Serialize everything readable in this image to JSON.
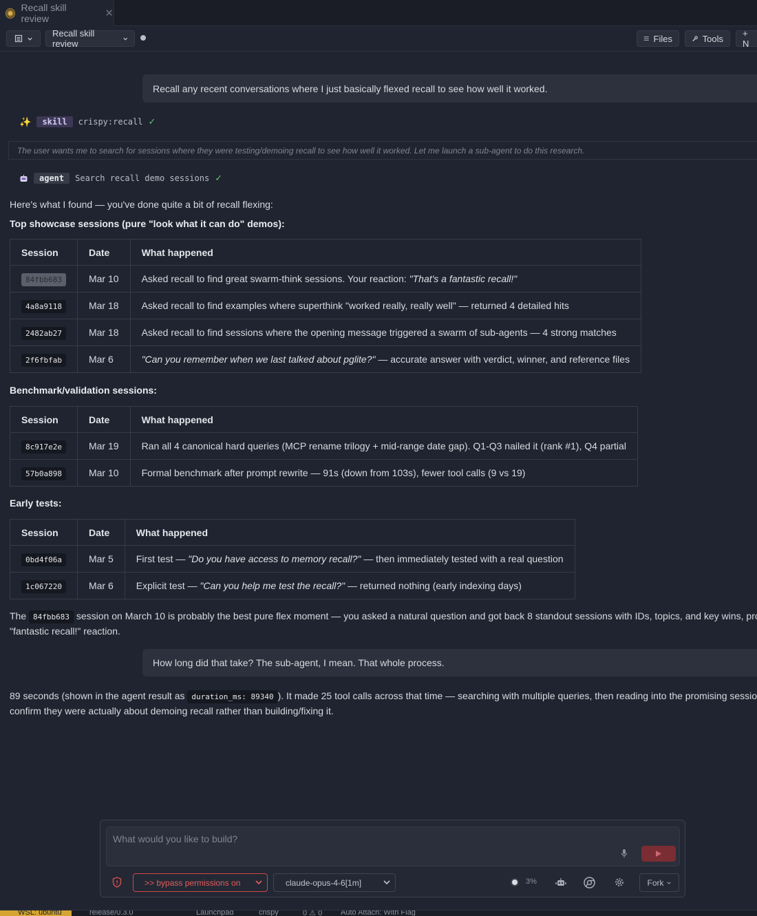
{
  "tab": {
    "title": "Recall skill review",
    "close": "✕"
  },
  "toolbar": {
    "session_name": "Recall skill review",
    "files_label": "Files",
    "tools_label": "Tools",
    "new_label": "+ N"
  },
  "messages": {
    "user1": "Recall any recent conversations where I just basically flexed recall to see how well it worked.",
    "skill_pill": "skill",
    "skill_name": "crispy:recall",
    "thinking": "The user wants me to search for sessions where they were testing/demoing recall to see how well it worked. Let me launch a sub-agent to do this research.",
    "agent_pill": "agent",
    "agent_task": "Search recall demo sessions",
    "intro": "Here's what I found — you've done quite a bit of recall flexing:",
    "heading1": "Top showcase sessions (pure \"look what it can do\" demos):",
    "heading2": "Benchmark/validation sessions:",
    "heading3": "Early tests:",
    "summary_pre": "The",
    "summary_code": "84fbb683",
    "summary_post": "session on March 10 is probably the best pure flex moment — you asked a natural question and got back 8 standout sessions with IDs, topics, and key wins, prompting",
    "summary_line2": "\"fantastic recall!\" reaction.",
    "user2": "How long did that take? The sub-agent, I mean. That whole process.",
    "answer_pre": "89 seconds (shown in the agent result as",
    "answer_code": "duration_ms: 89340",
    "answer_post": "). It made 25 tool calls across that time — searching with multiple queries, then reading into the promising sessions to",
    "answer_line2": "confirm they were actually about demoing recall rather than building/fixing it."
  },
  "table_headers": {
    "session": "Session",
    "date": "Date",
    "what": "What happened"
  },
  "table1": [
    {
      "session": "84fbb683",
      "date": "Mar 10",
      "pre": "Asked recall to find great swarm-think sessions. Your reaction: ",
      "quote": "\"That's a fantastic recall!\"",
      "post": ""
    },
    {
      "session": "4a8a9118",
      "date": "Mar 18",
      "pre": "Asked recall to find examples where superthink \"worked really, really well\" — returned 4 detailed hits",
      "quote": "",
      "post": ""
    },
    {
      "session": "2482ab27",
      "date": "Mar 18",
      "pre": "Asked recall to find sessions where the opening message triggered a swarm of sub-agents — 4 strong matches",
      "quote": "",
      "post": ""
    },
    {
      "session": "2f6fbfab",
      "date": "Mar 6",
      "pre": "",
      "quote": "\"Can you remember when we last talked about pglite?\"",
      "post": " — accurate answer with verdict, winner, and reference files"
    }
  ],
  "table2": [
    {
      "session": "8c917e2e",
      "date": "Mar 19",
      "pre": "Ran all 4 canonical hard queries (MCP rename trilogy + mid-range date gap). Q1-Q3 nailed it (rank #1), Q4 partial",
      "quote": "",
      "post": ""
    },
    {
      "session": "57b0a898",
      "date": "Mar 10",
      "pre": "Formal benchmark after prompt rewrite — 91s (down from 103s), fewer tool calls (9 vs 19)",
      "quote": "",
      "post": ""
    }
  ],
  "table3": [
    {
      "session": "0bd4f06a",
      "date": "Mar 5",
      "pre": "First test — ",
      "quote": "\"Do you have access to memory recall?\"",
      "post": " — then immediately tested with a real question"
    },
    {
      "session": "1c067220",
      "date": "Mar 6",
      "pre": "Explicit test — ",
      "quote": "\"Can you help me test the recall?\"",
      "post": " — returned nothing (early indexing days)"
    }
  ],
  "composer": {
    "placeholder": "What would you like to build?",
    "permission_mode": ">> bypass permissions on",
    "model": "claude-opus-4-6[1m]",
    "context_pct": "3%",
    "fork_label": "Fork"
  },
  "status": {
    "remote": "WSL: ubuntu",
    "branch": "release/0.3.0",
    "launchpad": "Launchpad",
    "project": "crispy",
    "problems": "0 ⚠ 0",
    "attach": "Auto Attach: With Flag"
  },
  "colors": {
    "background": "#1f2430",
    "user_bubble": "#2c313d",
    "skill_pill": "#3d3856",
    "success": "#5fc36b",
    "danger": "#e45d5d",
    "send": "#7a2d33",
    "remote": "#d6a531"
  }
}
